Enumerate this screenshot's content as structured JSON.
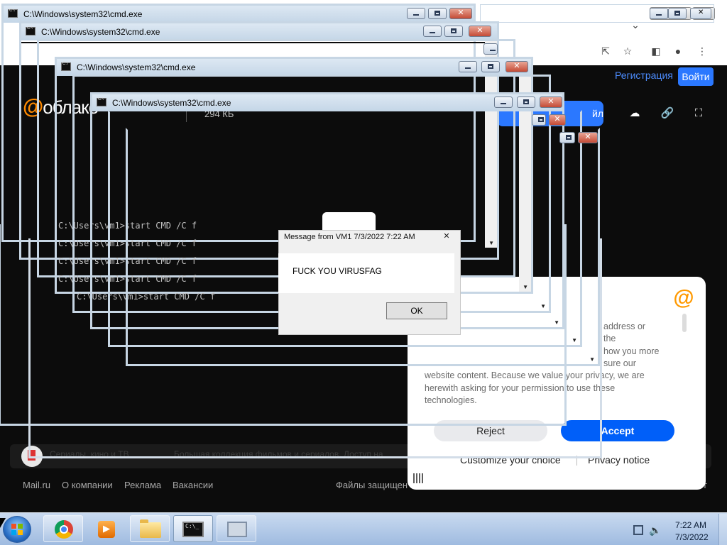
{
  "browser": {
    "register_label": "Регистрация",
    "login_label": "Войти",
    "logo_at": "@",
    "logo_rest": "облако",
    "file_size": "294 КБ",
    "download_label": "йл",
    "promo_title": "Сериалы, кино и ТВ",
    "promo_desc": "Большая коллекция фильмов и сериалов. Доступ на",
    "footer_links": [
      "Mail.ru",
      "О компании",
      "Реклама",
      "Вакансии"
    ],
    "footer_right": "Файлы защищен",
    "footer_edge": "т"
  },
  "cookie": {
    "at_symbol": "@",
    "lines": [
      "address or",
      "the",
      "how you more",
      "sure our",
      "website content. Because we value your privacy, we are",
      "herewith asking for your permission to use these",
      "technologies."
    ],
    "reject_label": "Reject",
    "accept_label": "Accept",
    "customize_label": "Customize your choice",
    "privacy_label": "Privacy notice"
  },
  "cmd": {
    "title": "C:\\Windows\\system32\\cmd.exe",
    "command_line": "C:\\Users\\vm1>start CMD /C f"
  },
  "msgbox": {
    "title": "Message from VM1 7/3/2022 7:22 AM",
    "text": "FUCK YOU VIRUSFAG",
    "ok_label": "OK"
  },
  "taskbar": {
    "time": "7:22 AM",
    "date": "7/3/2022",
    "volume_glyph": "🔈"
  }
}
